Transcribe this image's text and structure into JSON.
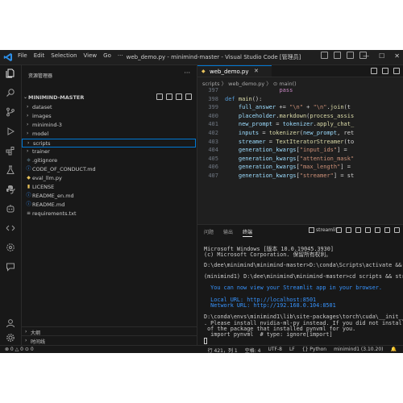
{
  "window": {
    "title": "web_demo.py - minimind-master - Visual Studio Code [管理员]",
    "menus": [
      "File",
      "Edit",
      "Selection",
      "View",
      "Go",
      "···"
    ],
    "controls": {
      "minimize": "—",
      "maximize": "☐",
      "close": "✕"
    }
  },
  "sidebar": {
    "header": "资源管理器",
    "more": "···",
    "project": "MINIMIND-MASTER",
    "items": [
      {
        "label": "dataset",
        "type": "folder"
      },
      {
        "label": "images",
        "type": "folder"
      },
      {
        "label": "minimind-3",
        "type": "folder"
      },
      {
        "label": "model",
        "type": "folder"
      },
      {
        "label": "scripts",
        "type": "folder",
        "selected": true
      },
      {
        "label": "trainer",
        "type": "folder"
      },
      {
        "label": ".gitignore",
        "type": "git"
      },
      {
        "label": "CODE_OF_CONDUCT.md",
        "type": "md"
      },
      {
        "label": "eval_llm.py",
        "type": "py"
      },
      {
        "label": "LICENSE",
        "type": "license"
      },
      {
        "label": "README_en.md",
        "type": "md"
      },
      {
        "label": "README.md",
        "type": "md"
      },
      {
        "label": "requirements.txt",
        "type": "txt"
      }
    ],
    "bottom_sections": [
      "大纲",
      "时间线"
    ]
  },
  "editor": {
    "tab_label": "web_demo.py",
    "breadcrumb": "scripts 〉 web_demo.py 〉 ⊙ main()",
    "lines": [
      {
        "n": "397",
        "indent": "                ",
        "tokens": [
          {
            "t": "pass",
            "c": "kw2"
          }
        ]
      },
      {
        "n": "398",
        "indent": "",
        "tokens": [
          {
            "t": "def ",
            "c": "kw"
          },
          {
            "t": "main",
            "c": "fn"
          },
          {
            "t": "():",
            "c": ""
          }
        ]
      },
      {
        "n": "399",
        "indent": "    ",
        "tokens": [
          {
            "t": "full_answer",
            "c": "id"
          },
          {
            "t": " += ",
            "c": ""
          },
          {
            "t": "\"\\n\"",
            "c": "str"
          },
          {
            "t": " + ",
            "c": ""
          },
          {
            "t": "\"\\n\"",
            "c": "str"
          },
          {
            "t": ".",
            "c": ""
          },
          {
            "t": "join",
            "c": "fn"
          },
          {
            "t": "(t",
            "c": ""
          }
        ]
      },
      {
        "n": "400",
        "indent": "    ",
        "tokens": [
          {
            "t": "placeholder",
            "c": "id"
          },
          {
            "t": ".",
            "c": ""
          },
          {
            "t": "markdown",
            "c": "fn"
          },
          {
            "t": "(",
            "c": ""
          },
          {
            "t": "process_assis",
            "c": "fn"
          }
        ]
      },
      {
        "n": "401",
        "indent": "    ",
        "tokens": [
          {
            "t": "new_prompt",
            "c": "id"
          },
          {
            "t": " = ",
            "c": ""
          },
          {
            "t": "tokenizer",
            "c": "id"
          },
          {
            "t": ".",
            "c": ""
          },
          {
            "t": "apply_chat_",
            "c": "fn"
          }
        ]
      },
      {
        "n": "402",
        "indent": "    ",
        "tokens": [
          {
            "t": "inputs",
            "c": "id"
          },
          {
            "t": " = ",
            "c": ""
          },
          {
            "t": "tokenizer",
            "c": "fn"
          },
          {
            "t": "(",
            "c": ""
          },
          {
            "t": "new_prompt",
            "c": "id"
          },
          {
            "t": ", ret",
            "c": ""
          }
        ]
      },
      {
        "n": "403",
        "indent": "    ",
        "tokens": [
          {
            "t": "streamer",
            "c": "id"
          },
          {
            "t": " = ",
            "c": ""
          },
          {
            "t": "TextIteratorStreamer",
            "c": "fn"
          },
          {
            "t": "(to",
            "c": ""
          }
        ]
      },
      {
        "n": "404",
        "indent": "    ",
        "tokens": [
          {
            "t": "generation_kwargs",
            "c": "id"
          },
          {
            "t": "[",
            "c": ""
          },
          {
            "t": "\"input_ids\"",
            "c": "str"
          },
          {
            "t": "] = ",
            "c": ""
          }
        ]
      },
      {
        "n": "405",
        "indent": "    ",
        "tokens": [
          {
            "t": "generation_kwargs",
            "c": "id"
          },
          {
            "t": "[",
            "c": ""
          },
          {
            "t": "\"attention_mask\"",
            "c": "str"
          }
        ]
      },
      {
        "n": "406",
        "indent": "    ",
        "tokens": [
          {
            "t": "generation_kwargs",
            "c": "id"
          },
          {
            "t": "[",
            "c": ""
          },
          {
            "t": "\"max_length\"",
            "c": "str"
          },
          {
            "t": "] = ",
            "c": ""
          }
        ]
      },
      {
        "n": "407",
        "indent": "    ",
        "tokens": [
          {
            "t": "generation_kwargs",
            "c": "id"
          },
          {
            "t": "[",
            "c": ""
          },
          {
            "t": "\"streamer\"",
            "c": "str"
          },
          {
            "t": "] = st",
            "c": ""
          }
        ]
      }
    ]
  },
  "panel": {
    "tabs": [
      "问题",
      "输出",
      "终端"
    ],
    "active_tab": "终端",
    "terminal_name": "streamlit",
    "lines": [
      {
        "text": "Microsoft Windows [版本 10.0.19045.3930]",
        "style": ""
      },
      {
        "text": "(c) Microsoft Corporation. 保留所有权利。",
        "style": ""
      },
      {
        "text": "",
        "style": ""
      },
      {
        "text": "D:\\dee\\minimind\\minimind-master>D:\\conda\\Scripts\\activate &&",
        "style": ""
      },
      {
        "text": "",
        "style": ""
      },
      {
        "text": "(minimind1) D:\\dee\\minimind\\minimind-master>cd scripts && str",
        "style": ""
      },
      {
        "text": "",
        "style": ""
      },
      {
        "text": "  You can now view your Streamlit app in your browser.",
        "style": "blue"
      },
      {
        "text": "",
        "style": ""
      },
      {
        "text": "  Local URL: http://localhost:8501",
        "style": "blue"
      },
      {
        "text": "  Network URL: http://192.168.0.104:8501",
        "style": "blue"
      },
      {
        "text": "",
        "style": ""
      },
      {
        "text": "D:\\conda\\envs\\minimind1\\lib\\site-packages\\torch\\cuda\\__init__",
        "style": ""
      },
      {
        "text": ". Please install nvidia-ml-py instead. If you did not install",
        "style": ""
      },
      {
        "text": " of the package that installed pynvml for you.",
        "style": ""
      },
      {
        "text": "  import pynvml  # type: ignore[import]",
        "style": ""
      }
    ]
  },
  "status": {
    "left": "⊗ 0 △ 0  ⊙ 0",
    "position": "行 421，列 1",
    "spaces": "空格: 4",
    "encoding": "UTF-8",
    "eol": "LF",
    "language": "{} Python",
    "interpreter": "minimind1 (3.10.20)",
    "bell": "🔔"
  },
  "colors": {
    "accent": "#0078d4",
    "background": "#1f1f1f",
    "sidebar": "#181818",
    "link": "#3794ff"
  }
}
